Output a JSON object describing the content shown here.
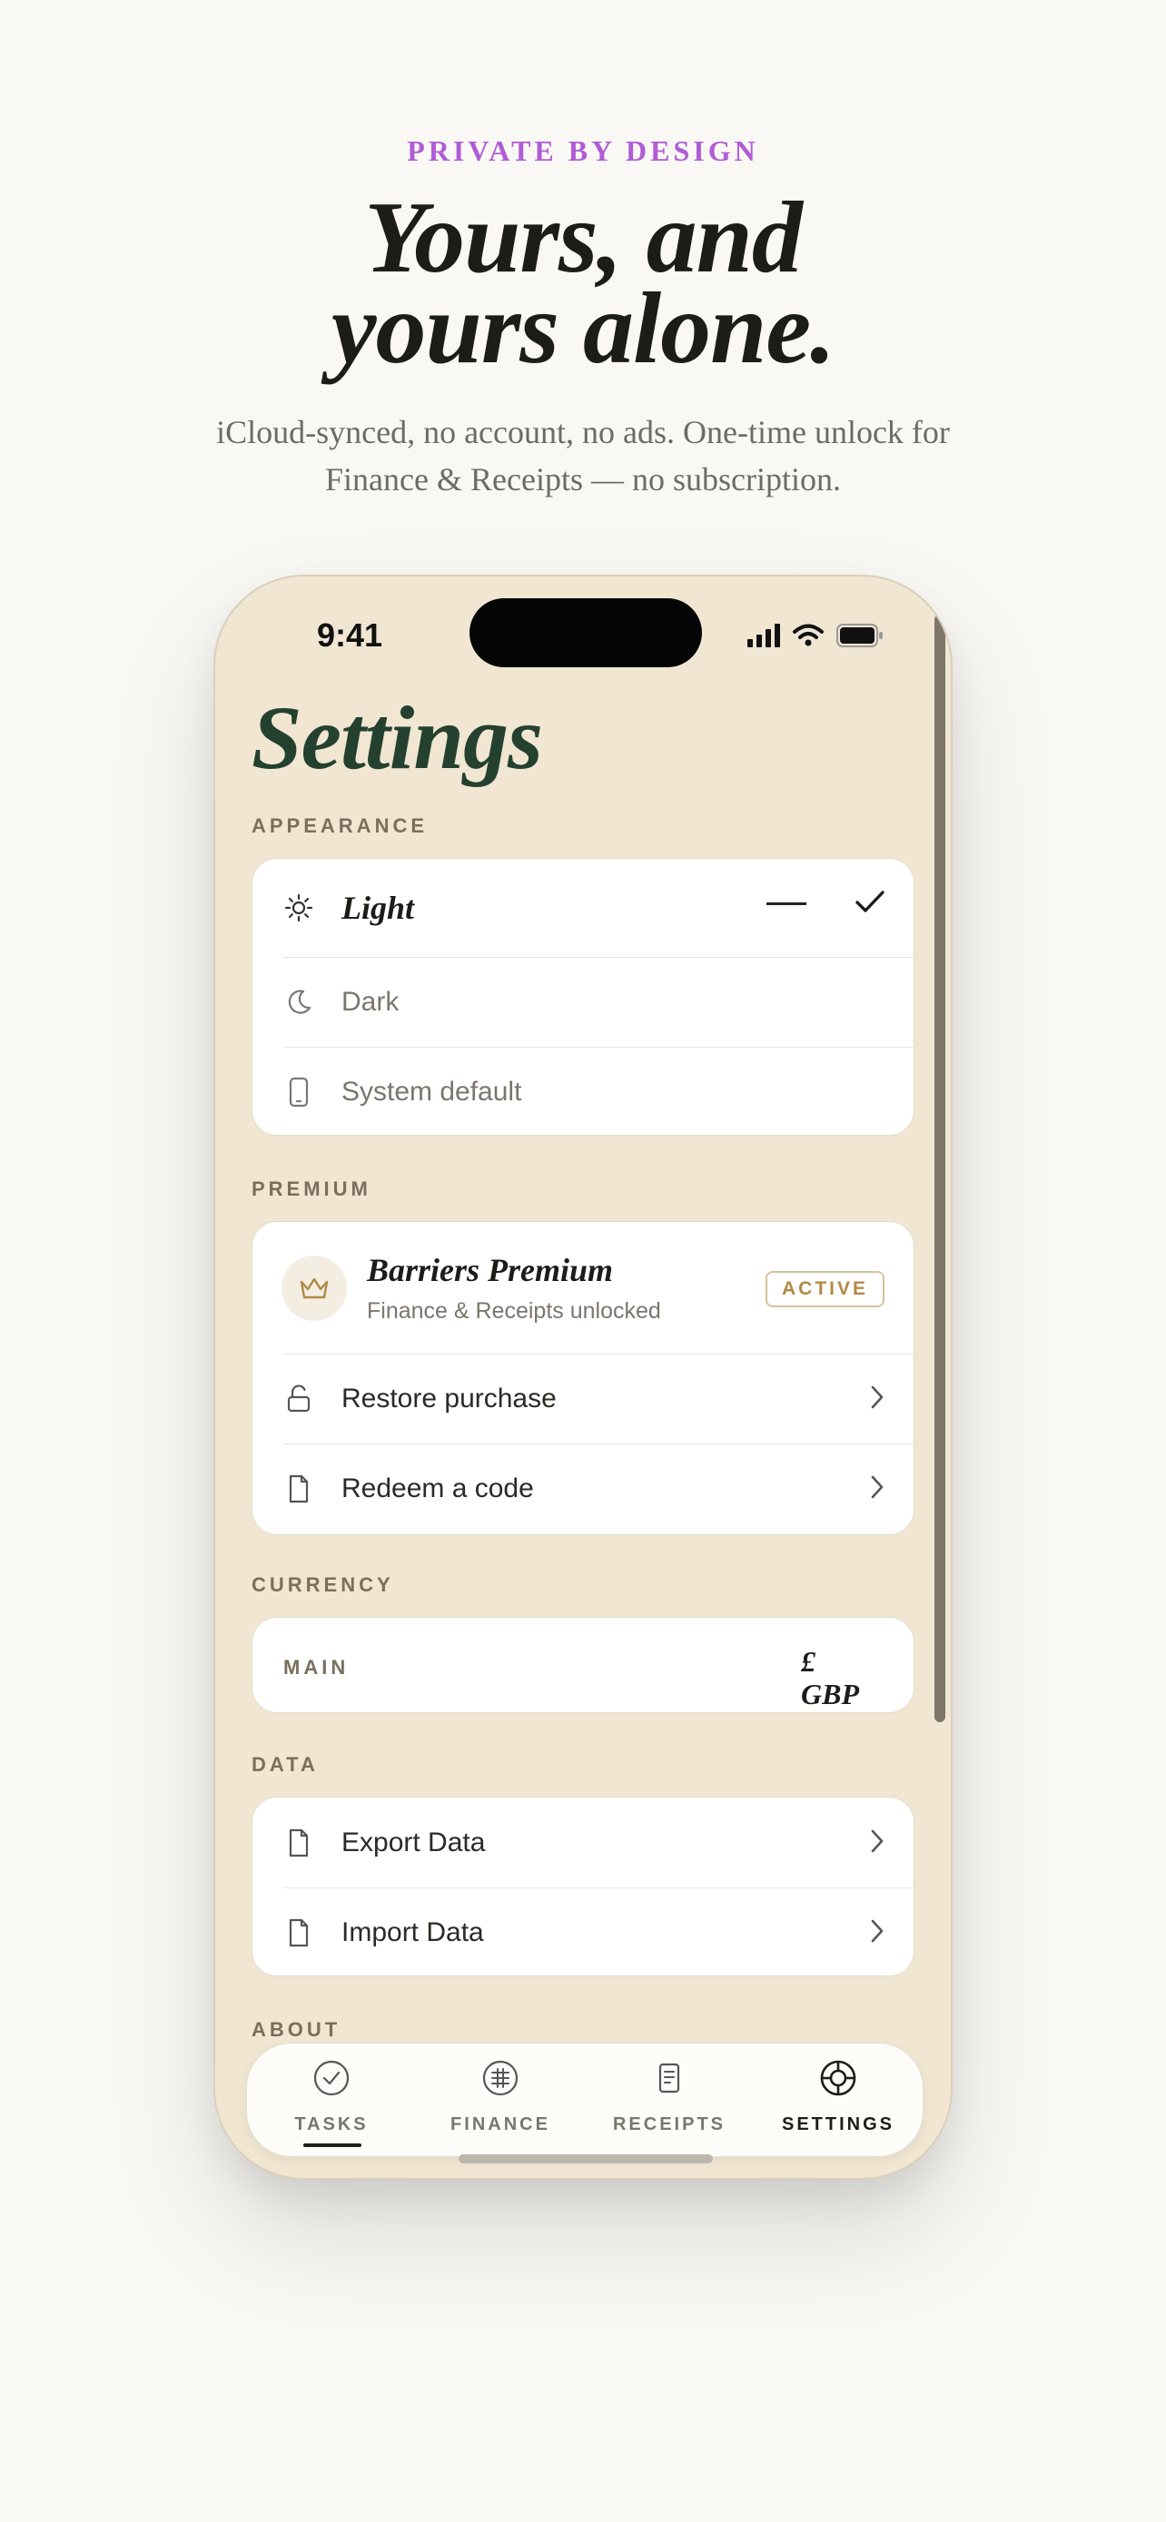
{
  "hero": {
    "eyebrow": "PRIVATE BY DESIGN",
    "headline_line1": "Yours, and",
    "headline_line2": "yours alone.",
    "subtitle": "iCloud-synced, no account, no ads. One-time unlock for Finance & Receipts — no subscription."
  },
  "status_bar": {
    "time": "9:41"
  },
  "settings": {
    "title": "Settings",
    "appearance": {
      "label": "APPEARANCE",
      "options": [
        {
          "label": "Light",
          "icon": "sun-icon",
          "selected": true
        },
        {
          "label": "Dark",
          "icon": "moon-icon",
          "selected": false
        },
        {
          "label": "System default",
          "icon": "phone-icon",
          "selected": false
        }
      ]
    },
    "premium": {
      "label": "PREMIUM",
      "name": "Barriers Premium",
      "subtitle": "Finance & Receipts unlocked",
      "badge": "ACTIVE",
      "restore": "Restore purchase",
      "redeem": "Redeem a code"
    },
    "currency": {
      "label": "CURRENCY",
      "key": "MAIN",
      "value_symbol": "£",
      "value_code": "GBP"
    },
    "data": {
      "label": "DATA",
      "export": "Export Data",
      "import": "Import Data"
    },
    "about": {
      "label": "ABOUT"
    }
  },
  "tabs": [
    {
      "label": "TASKS",
      "icon": "check-circle-icon"
    },
    {
      "label": "FINANCE",
      "icon": "ledger-circle-icon"
    },
    {
      "label": "RECEIPTS",
      "icon": "receipt-icon"
    },
    {
      "label": "SETTINGS",
      "icon": "lifebuoy-icon",
      "active": true
    }
  ],
  "colors": {
    "eyebrow": "#b05cd6",
    "title_green": "#24412f",
    "phone_bg": "#f0e6d2",
    "badge_gold": "#b08a45"
  }
}
